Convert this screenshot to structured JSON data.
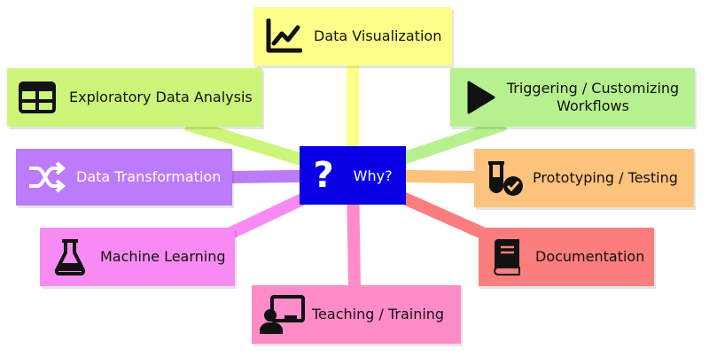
{
  "center": {
    "icon": "question-mark-icon",
    "glyph": "?",
    "label": "Why?",
    "color": "#0a00e6"
  },
  "nodes": [
    {
      "id": "data-visualization",
      "label": "Data Visualization",
      "icon": "line-chart-icon",
      "color": "#fdff88"
    },
    {
      "id": "exploratory-data-analysis",
      "label": "Exploratory Data Analysis",
      "icon": "table-icon",
      "color": "#ccf579"
    },
    {
      "id": "triggering-customizing-workflows",
      "label": "Triggering / Customizing Workflows",
      "icon": "play-icon",
      "color": "#b7f18f"
    },
    {
      "id": "data-transformation",
      "label": "Data Transformation",
      "icon": "shuffle-icon",
      "color": "#bc7bfa"
    },
    {
      "id": "prototyping-testing",
      "label": "Prototyping / Testing",
      "icon": "test-tube-check-icon",
      "color": "#fdc27c"
    },
    {
      "id": "machine-learning",
      "label": "Machine Learning",
      "icon": "flask-icon",
      "color": "#f78bf3"
    },
    {
      "id": "documentation",
      "label": "Documentation",
      "icon": "book-icon",
      "color": "#fb7d7e"
    },
    {
      "id": "teaching-training",
      "label": "Teaching / Training",
      "icon": "presenter-icon",
      "color": "#ff8bc9"
    }
  ]
}
